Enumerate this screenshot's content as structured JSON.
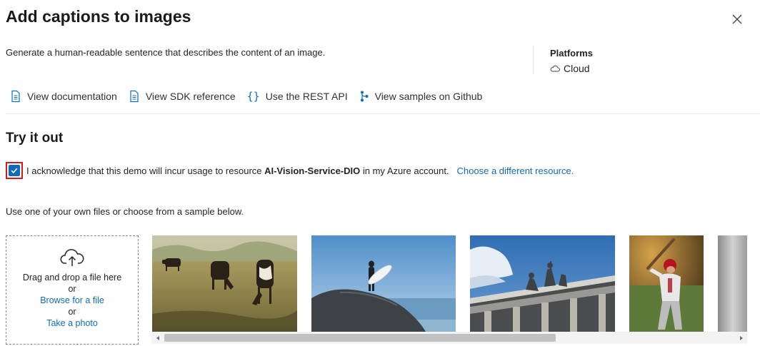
{
  "header": {
    "title": "Add captions to images",
    "close_icon": "close-icon"
  },
  "description": "Generate a human-readable sentence that describes the content of an image.",
  "platforms": {
    "heading": "Platforms",
    "value": "Cloud",
    "icon": "cloud-icon"
  },
  "links": [
    {
      "label": "View documentation",
      "icon": "document-icon"
    },
    {
      "label": "View SDK reference",
      "icon": "document-icon"
    },
    {
      "label": "Use the REST API",
      "icon": "curly-braces-icon"
    },
    {
      "label": "View samples on Github",
      "icon": "branch-icon"
    }
  ],
  "try_it": {
    "title": "Try it out",
    "checkbox_checked": true,
    "ack_prefix": "I acknowledge that this demo will incur usage to resource ",
    "ack_resource": "AI-Vision-Service-DIO",
    "ack_suffix": " in my Azure account.",
    "change_link": "Choose a different resource.",
    "hint": "Use one of your own files or choose from a sample below."
  },
  "dropzone": {
    "icon": "cloud-upload-icon",
    "line1": "Drag and drop a file here",
    "or1": "or",
    "browse": "Browse for a file",
    "or2": "or",
    "photo": "Take a photo"
  },
  "samples": [
    {
      "name": "cows-grazing-image"
    },
    {
      "name": "surfer-on-rock-image"
    },
    {
      "name": "building-statues-image"
    },
    {
      "name": "baseball-batter-image"
    },
    {
      "name": "gray-partial-image"
    }
  ],
  "colors": {
    "accent": "#0f6cbd",
    "highlight_border": "#d11a1a"
  }
}
